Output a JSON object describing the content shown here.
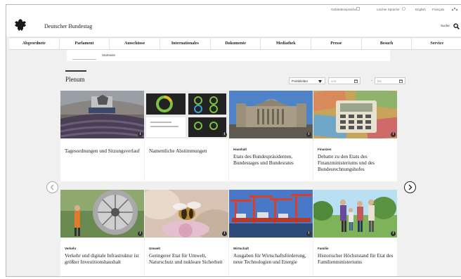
{
  "topbar": {
    "links": [
      {
        "label": "Gebärdensprache",
        "icon": "sign-language-icon"
      },
      {
        "label": "Leichte Sprache",
        "icon": "easy-language-icon"
      },
      {
        "label": "English"
      },
      {
        "label": "Français"
      },
      {
        "icon": "share-icon"
      }
    ]
  },
  "header": {
    "title": "Deutscher Bundestag",
    "search_label": "Suche"
  },
  "nav": {
    "items": [
      "Abgeordnete",
      "Parlament",
      "Ausschüsse",
      "Internationales",
      "Dokumente",
      "Mediathek",
      "Presse",
      "Besuch",
      "Service"
    ]
  },
  "subnav": {
    "items": [
      "Startseite"
    ]
  },
  "section": {
    "title": "Plenum",
    "filter_label": "Politikfelder",
    "date_from_placeholder": "von",
    "date_to_placeholder": "bis",
    "date_separator": "-"
  },
  "cards": [
    {
      "category": "",
      "title": "Tagesordnungen und Sitzungsverlauf",
      "image": "plenary-hall"
    },
    {
      "category": "",
      "title": "Namentliche Abstimmungen",
      "image": "vote-charts"
    },
    {
      "category": "Haushalt",
      "title": "Etats des Bundespräsi­denten, Bundestages und Bundesrates",
      "image": "reichstag-building"
    },
    {
      "category": "Finanzen",
      "title": "Debatte zu den Etats des Finanzministeriums und des Bundesrechnungshofes",
      "image": "money-calculator"
    },
    {
      "category": "Verkehr",
      "title": "Verkehr und digitale Infrastruktur ist größter Investitionshaushalt",
      "image": "cable-drum"
    },
    {
      "category": "Umwelt",
      "title": "Geringerer Etat für Umwelt, Naturschutz und nukleare Sicherheit",
      "image": "bee-flower"
    },
    {
      "category": "Wirtschaft",
      "title": "Ausgaben für Wirtschafts­förderung, neue Tech­nologien und Energie",
      "image": "port-cranes"
    },
    {
      "category": "Familie",
      "title": "Historischer Höchststand für Etat des Familien­ministeriums",
      "image": "family-walk"
    }
  ]
}
